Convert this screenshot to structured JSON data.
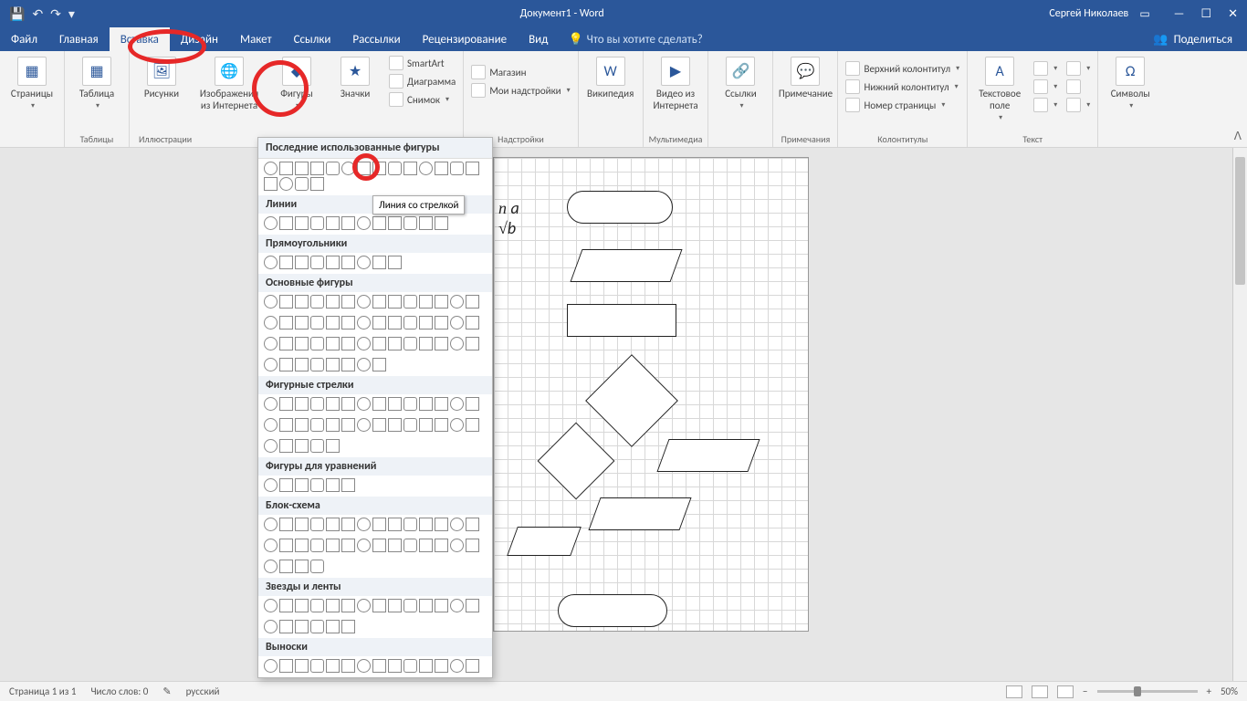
{
  "title": "Документ1 - Word",
  "user": "Сергей Николаев",
  "qat": {
    "save": "💾",
    "undo": "↶",
    "redo": "↷",
    "customize": "▾"
  },
  "winctrl": {
    "min": "—",
    "max": "☐",
    "close": "✕",
    "ribbonopts": "▭"
  },
  "tabs": [
    "Файл",
    "Главная",
    "Вставка",
    "Дизайн",
    "Макет",
    "Ссылки",
    "Рассылки",
    "Рецензирование",
    "Вид"
  ],
  "active_tab_index": 2,
  "tell_me": "Что вы хотите сделать?",
  "share": "Поделиться",
  "ribbon_groups": {
    "pages": {
      "btn": "Страницы",
      "label": ""
    },
    "tables": {
      "btn": "Таблица",
      "label": "Таблицы"
    },
    "illus": {
      "pics": "Рисунки",
      "onlinepics": "Изображения из Интернета",
      "shapes": "Фигуры",
      "icons": "Значки",
      "smartart": "SmartArt",
      "chart": "Диаграмма",
      "screenshot": "Снимок",
      "label": "Иллюстрации"
    },
    "addins": {
      "store": "Магазин",
      "myaddins": "Мои надстройки",
      "label": "Надстройки"
    },
    "wikipedia": "Википедия",
    "media": {
      "btn_l1": "Видео из",
      "btn_l2": "Интернета",
      "label": "Мультимедиа"
    },
    "links": {
      "btn": "Ссылки",
      "label": ""
    },
    "comments": {
      "btn": "Примечание",
      "label": "Примечания"
    },
    "headerfooter": {
      "header": "Верхний колонтитул",
      "footer": "Нижний колонтитул",
      "pagenum": "Номер страницы",
      "label": "Колонтитулы"
    },
    "text": {
      "textbox_l1": "Текстовое",
      "textbox_l2": "поле",
      "label": "Текст"
    },
    "symbols": {
      "btn": "Символы",
      "label": ""
    }
  },
  "shapes_panel": {
    "header": "Последние использованные фигуры",
    "tooltip": "Линия со стрелкой",
    "cats": [
      {
        "name": "Линии",
        "count": 12
      },
      {
        "name": "Прямоугольники",
        "count": 9
      },
      {
        "name": "Основные фигуры",
        "count_rows": [
          14,
          14,
          14,
          8
        ]
      },
      {
        "name": "Фигурные стрелки",
        "count_rows": [
          14,
          14,
          5
        ]
      },
      {
        "name": "Фигуры для уравнений",
        "count": 6
      },
      {
        "name": "Блок-схема",
        "count_rows": [
          14,
          14,
          4
        ]
      },
      {
        "name": "Звезды и ленты",
        "count_rows": [
          14,
          6
        ]
      },
      {
        "name": "Выноски",
        "count": 14
      }
    ],
    "recent_count": 18
  },
  "math": "n a\n√b",
  "status": {
    "page": "Страница 1 из 1",
    "words": "Число слов: 0",
    "lang_icon": "✎",
    "lang": "русский",
    "zoom_pct": "50%",
    "zoom_minus": "−",
    "zoom_plus": "+"
  }
}
